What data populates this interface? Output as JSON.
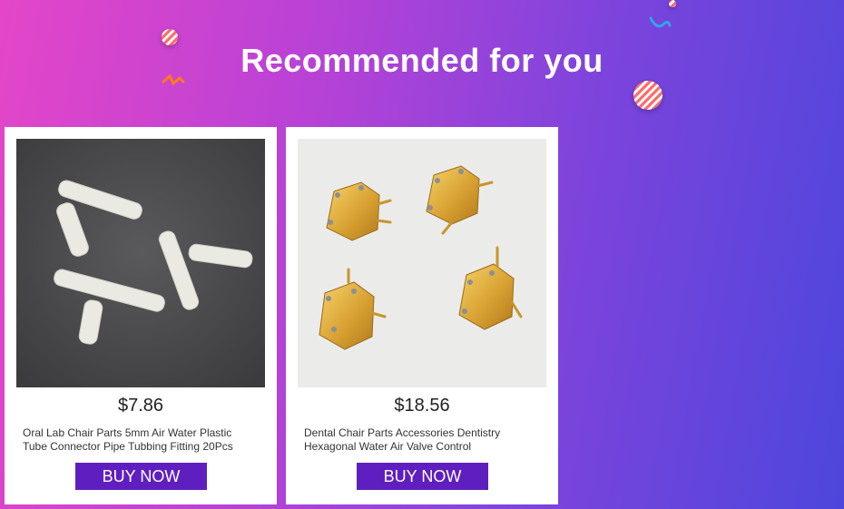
{
  "header": {
    "title": "Recommended for you"
  },
  "colors": {
    "button": "#5f1fc0",
    "card": "#ffffff"
  },
  "products": [
    {
      "price": "$7.86",
      "name": "Oral Lab Chair Parts 5mm Air Water Plastic Tube Connector Pipe Tubbing Fitting 20Pcs",
      "button_label": "BUY NOW",
      "image": "white-plastic-t-connectors"
    },
    {
      "price": "$18.56",
      "name": "Dental Chair Parts Accessories Dentistry Hexagonal Water Air Valve Control",
      "button_label": "BUY NOW",
      "image": "brass-hexagonal-valves"
    }
  ]
}
